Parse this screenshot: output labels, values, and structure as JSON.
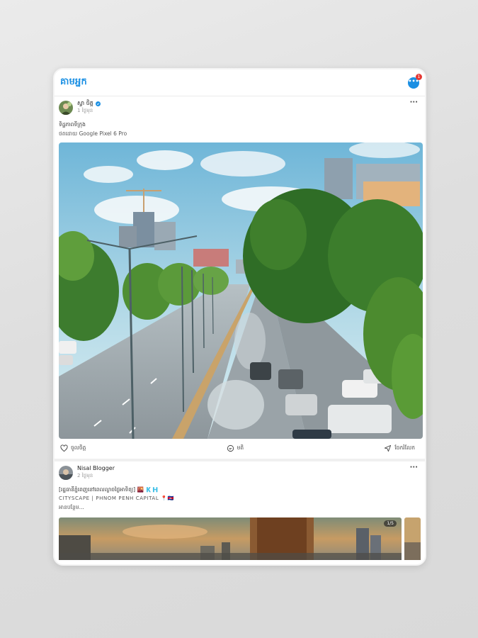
{
  "app": {
    "logo_text": "គាមអ្នក",
    "message_badge_count": "1",
    "accent_color": "#1a8fe3"
  },
  "posts": [
    {
      "author": "ស្វា ចិត្ត",
      "verified": true,
      "time": "1 ថ្ងៃមុន",
      "caption_lines": [
        "ទិដ្ឋភាពទីក្រុង",
        "ថតដោយ Google Pixel 6 Pro"
      ],
      "actions": {
        "like_label": "ចូលចិត្ត",
        "comment_label": "មតិ",
        "share_label": "ចែករំលែក"
      }
    },
    {
      "author": "Nisal Blogger",
      "verified": false,
      "time": "2 ថ្ងៃមុន",
      "caption_lines": [
        "[រដ្ឋធានីភ្នំពេញនៅពេលល្ងាចថ្ងៃអាទិត្យ] 🌇 🇰🇭",
        "CITYSCAPE | PHNOM PENH CAPITAL 📍🇰🇭",
        "អានបន្ថែម..."
      ],
      "image_count_badge": "1/5"
    }
  ],
  "icons": [
    "messages-icon",
    "more-options-icon",
    "like-icon",
    "comment-icon",
    "share-icon",
    "verified-icon"
  ]
}
